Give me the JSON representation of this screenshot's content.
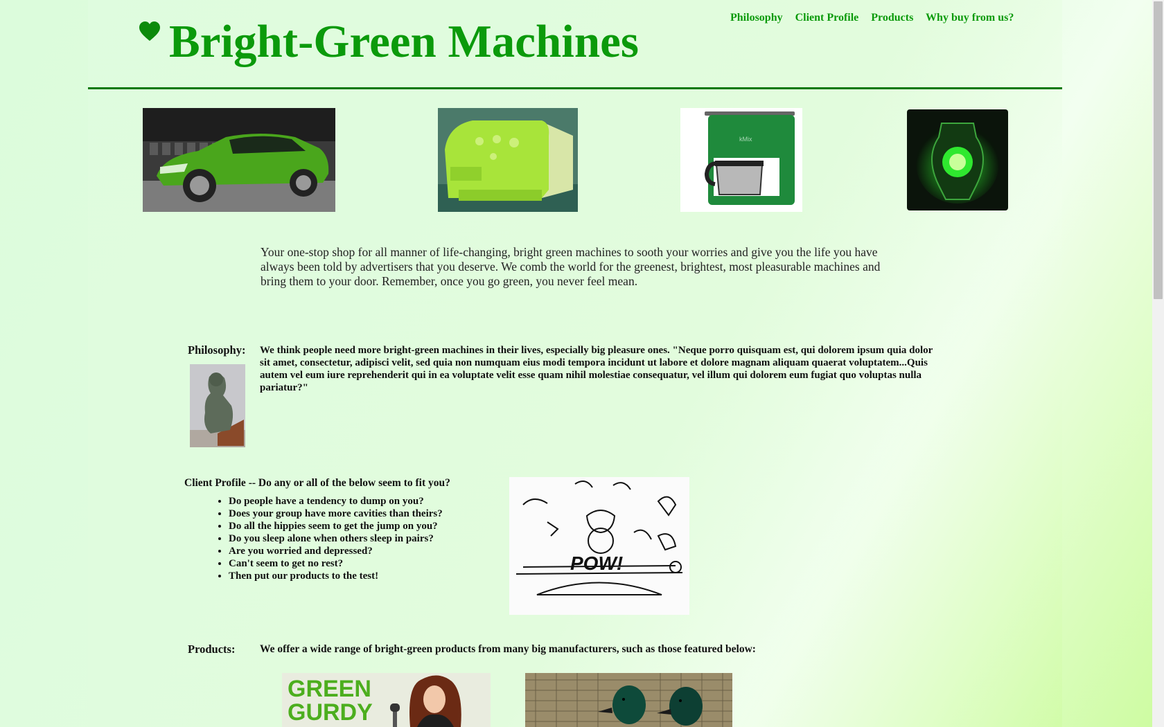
{
  "header": {
    "title": "Bright-Green Machines",
    "logo_icon": "heart-icon",
    "brand_color": "#0b9a0b"
  },
  "nav": {
    "items": [
      {
        "label": "Philosophy"
      },
      {
        "label": "Client Profile"
      },
      {
        "label": "Products"
      },
      {
        "label": "Why buy from us?"
      }
    ]
  },
  "gallery": [
    {
      "name": "green-car-image"
    },
    {
      "name": "green-sewing-machine-image"
    },
    {
      "name": "green-coffee-maker-image"
    },
    {
      "name": "green-lantern-image"
    }
  ],
  "intro": {
    "text": "Your one-stop shop for all manner of life-changing, bright green machines to sooth your worries and give you the life you have always been told by advertisers that you deserve. We comb the world for the greenest, brightest, most pleasurable machines and bring them to your door. Remember, once you go green, you never feel mean."
  },
  "philosophy": {
    "label": "Philosophy:",
    "text": "We think people need more bright-green machines in their lives, especially big pleasure ones. \"Neque porro quisquam est, qui dolorem ipsum quia dolor sit amet, consectetur, adipisci velit, sed quia non numquam eius modi tempora incidunt ut labore et dolore magnam aliquam quaerat voluptatem...Quis autem vel eum iure reprehenderit qui in ea voluptate velit esse quam nihil molestiae consequatur, vel illum qui dolorem eum fugiat quo voluptas nulla pariatur?\""
  },
  "client_profile": {
    "heading": "Client Profile -- Do any or all of the below seem to fit you?",
    "items": [
      "Do people have a tendency to dump on you?",
      "Does your group have more cavities than theirs?",
      "Do all the hippies seem to get the jump on you?",
      "Do you sleep alone when others sleep in pairs?",
      "Are you worried and depressed?",
      "Can't seem to get no rest?",
      "Then put our products to the test!"
    ],
    "comic_text": "POW!"
  },
  "products": {
    "label": "Products:",
    "text": "We offer a wide range of bright-green products from many big manufacturers, such as those featured below:",
    "thumb1_text": [
      "GREEN",
      "GURDY"
    ]
  }
}
